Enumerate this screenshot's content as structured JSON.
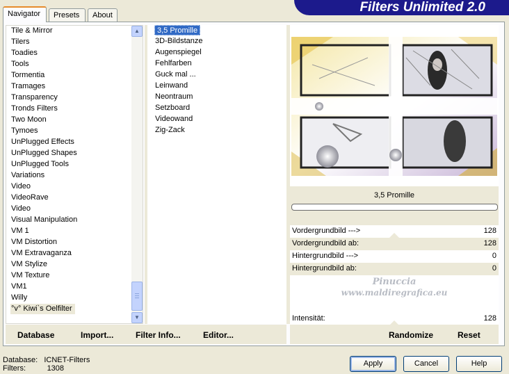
{
  "tabs": [
    "Navigator",
    "Presets",
    "About"
  ],
  "app_title": "Filters Unlimited 2.0",
  "categories": [
    "Tile & Mirror",
    "Tilers",
    "Toadies",
    "Tools",
    "Tormentia",
    "Tramages",
    "Transparency",
    "Tronds Filters",
    "Two Moon",
    "Tymoes",
    "UnPlugged Effects",
    "UnPlugged Shapes",
    "UnPlugged Tools",
    "Variations",
    "Video",
    "VideoRave",
    "Video",
    "Visual Manipulation",
    "VM 1",
    "VM Distortion",
    "VM Extravaganza",
    "VM Stylize",
    "VM Texture",
    "VM1",
    "Willy",
    "°v° Kiwi`s Oelfilter"
  ],
  "selected_category": "°v° Kiwi`s Oelfilter",
  "filters": [
    "3,5 Promille",
    "3D-Bildstanze",
    "Augenspiegel",
    "Fehlfarben",
    "Guck mal ...",
    "Leinwand",
    "Neontraum",
    "Setzboard",
    "Videowand",
    "Zig-Zack"
  ],
  "selected_filter": "3,5 Promille",
  "preview_filter_name": "3,5 Promille",
  "params": [
    {
      "label": "Vordergrundbild --->",
      "value": "128"
    },
    {
      "label": "Vordergrundbild ab:",
      "value": "128"
    },
    {
      "label": "Hintergrundbild --->",
      "value": "0"
    },
    {
      "label": "Hintergrundbild ab:",
      "value": "0"
    }
  ],
  "watermark": {
    "line1": "Pinuccia",
    "line2": "www.maldiregrafica.eu"
  },
  "intensity": {
    "label": "Intensität:",
    "value": "128"
  },
  "toolbar": {
    "database": "Database",
    "import": "Import...",
    "filter_info": "Filter Info...",
    "editor": "Editor...",
    "randomize": "Randomize",
    "reset": "Reset"
  },
  "status": {
    "database_label": "Database:",
    "database_value": "ICNET-Filters",
    "filters_label": "Filters:",
    "filters_value": "1308"
  },
  "buttons": {
    "apply": "Apply",
    "cancel": "Cancel",
    "help": "Help"
  },
  "colors": {
    "selection": "#316ac5",
    "banner": "#1c1a8c",
    "tab_accent": "#e68b2c"
  },
  "icons": [
    "scroll-up-icon",
    "scroll-down-icon"
  ]
}
